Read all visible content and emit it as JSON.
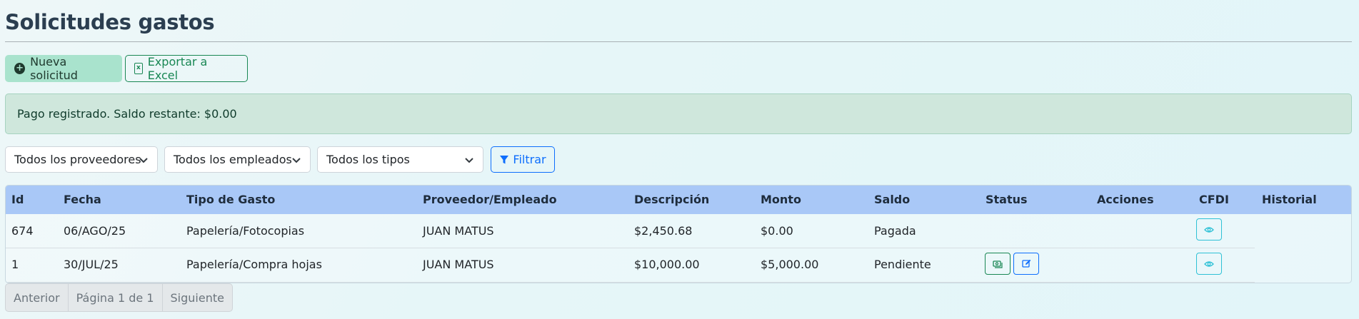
{
  "page": {
    "title": "Solicitudes gastos"
  },
  "toolbar": {
    "new_label": "Nueva solicitud",
    "export_label": "Exportar a Excel"
  },
  "alert": {
    "message": "Pago registrado. Saldo restante: $0.00"
  },
  "filters": {
    "proveedores": "Todos los proveedores",
    "empleados": "Todos los empleados",
    "tipos": "Todos los tipos",
    "filter_label": "Filtrar"
  },
  "table": {
    "headers": [
      "Id",
      "Fecha",
      "Tipo de Gasto",
      "Proveedor/Empleado",
      "Descripción",
      "Monto",
      "Saldo",
      "Status",
      "Acciones",
      "CFDI",
      "Historial"
    ],
    "rows": [
      {
        "id": "674",
        "fecha": "06/AGO/25",
        "tipo": "Papelería/Fotocopias",
        "proveedor": "JUAN MATUS",
        "descripcion": "$2,450.68",
        "monto": "$0.00",
        "saldo": "Pagada",
        "actions": [
          "eye-icon"
        ]
      },
      {
        "id": "1",
        "fecha": "30/JUL/25",
        "tipo": "Papelería/Compra hojas",
        "proveedor": "JUAN MATUS",
        "descripcion": "$10,000.00",
        "monto": "$5,000.00",
        "saldo": "Pendiente",
        "actions": [
          "cash-icon",
          "edit-icon",
          "eye-icon"
        ]
      }
    ]
  },
  "pagination": {
    "prev": "Anterior",
    "page": "Página 1 de 1",
    "next": "Siguiente"
  },
  "colors": {
    "success": "#198754",
    "primary": "#0d6efd",
    "info": "#2fc1d6",
    "header": "#a9c8f7",
    "alert_bg": "#cfe7dc"
  }
}
